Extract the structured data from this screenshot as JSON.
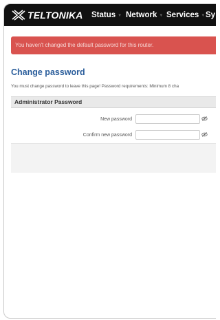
{
  "brand": {
    "name": "TELTONIKA",
    "logo_icon": "teltonika-cross-logo-icon"
  },
  "nav": {
    "items": [
      {
        "label": "Status",
        "icon": "chevron-down-icon"
      },
      {
        "label": "Network",
        "icon": "chevron-down-icon"
      },
      {
        "label": "Services",
        "icon": "chevron-down-icon"
      },
      {
        "label": "Sy"
      }
    ]
  },
  "alert": {
    "message": "You haven't changed the default password for this router.",
    "color": "#d9534f"
  },
  "page": {
    "title": "Change password",
    "description": "You must change password to leave this page! Password requirements: Minimum 8 cha"
  },
  "section": {
    "title": "Administrator Password"
  },
  "form": {
    "new_password_label": "New password",
    "new_password_value": "",
    "confirm_password_label": "Confirm new password",
    "confirm_password_value": "",
    "reveal_icon": "eye-icon"
  },
  "colors": {
    "topbar": "#111111",
    "title": "#2a5d9b",
    "section_header": "#e9e9e9"
  }
}
